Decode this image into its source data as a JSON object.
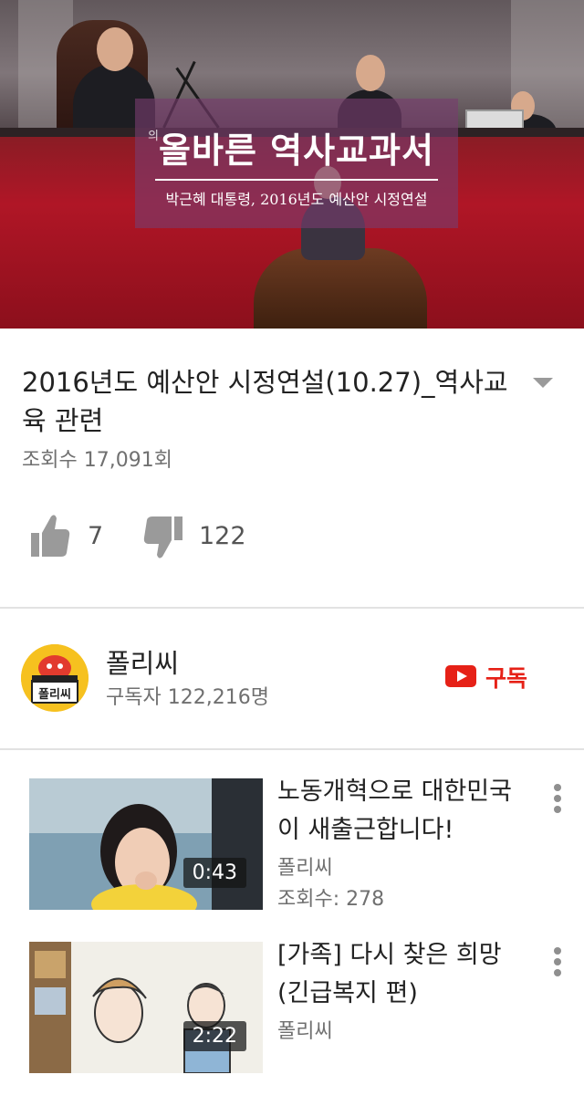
{
  "player": {
    "banner_title": "올바른 역사교과서",
    "banner_subtitle": "박근혜 대통령, 2016년도 예산안 시정연설",
    "banner_side": "의"
  },
  "video": {
    "title": "2016년도 예산안 시정연설(10.27)_역사교육 관련",
    "views": "조회수 17,091회",
    "likes": "7",
    "dislikes": "122"
  },
  "channel": {
    "name": "폴리씨",
    "subscribers": "구독자 122,216명",
    "subscribe_label": "구독",
    "avatar_text": "폴리씨"
  },
  "related": [
    {
      "title": "노동개혁으로 대한민국이 새출근합니다!",
      "channel": "폴리씨",
      "views": "조회수: 278",
      "duration": "0:43"
    },
    {
      "title": "[가족] 다시 찾은 희망 (긴급복지 편)",
      "channel": "폴리씨",
      "views": "",
      "duration": "2:22"
    }
  ],
  "colors": {
    "accent": "#e62117",
    "text_secondary": "#707070",
    "icon_gray": "#9a9a9a"
  }
}
